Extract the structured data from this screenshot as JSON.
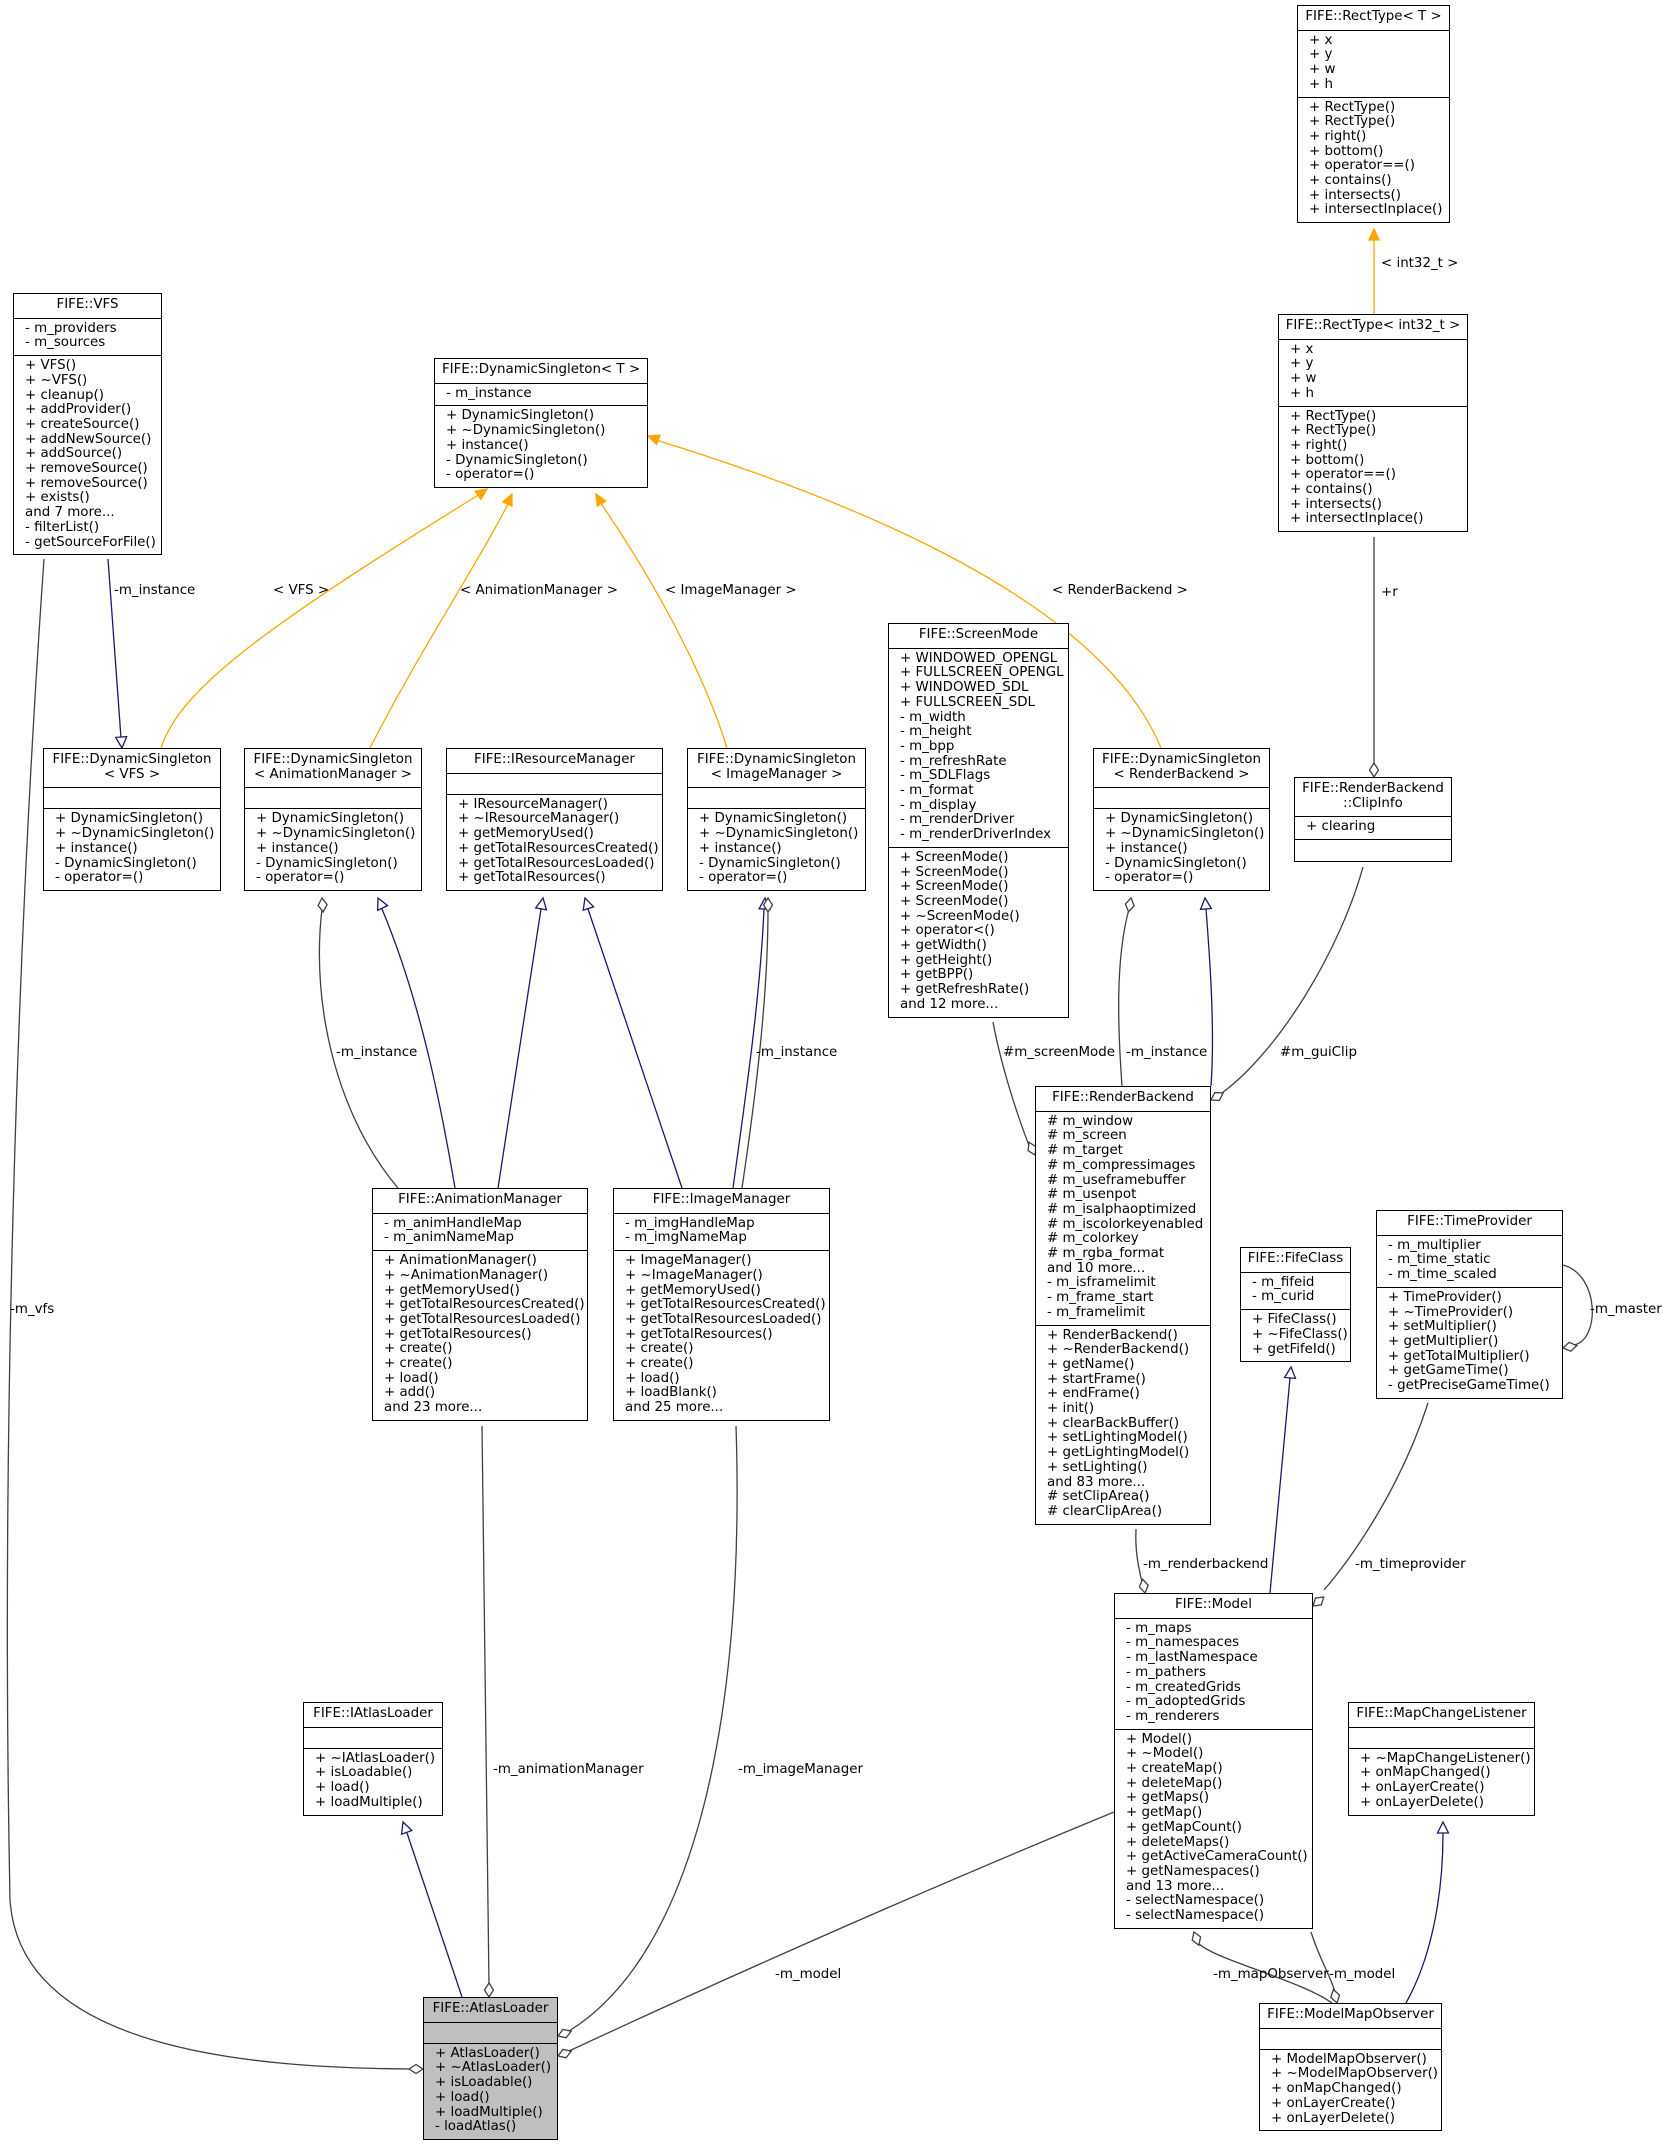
{
  "colors": {
    "inherit": "#191970",
    "template": "#FFA500",
    "usage": "#404040",
    "focus_fill": "#bfbfbf"
  },
  "nodes": [
    {
      "id": "recttype_t",
      "title": "FIFE::RectType< T >",
      "attrs": [
        "+ x",
        "+ y",
        "+ w",
        "+ h"
      ],
      "methods": [
        "+ RectType()",
        "+ RectType()",
        "+ right()",
        "+ bottom()",
        "+ operator==()",
        "+ contains()",
        "+ intersects()",
        "+ intersectInplace()"
      ]
    },
    {
      "id": "recttype_int32",
      "title": "FIFE::RectType< int32_t >",
      "attrs": [
        "+ x",
        "+ y",
        "+ w",
        "+ h"
      ],
      "methods": [
        "+ RectType()",
        "+ RectType()",
        "+ right()",
        "+ bottom()",
        "+ operator==()",
        "+ contains()",
        "+ intersects()",
        "+ intersectInplace()"
      ]
    },
    {
      "id": "vfs",
      "title": "FIFE::VFS",
      "attrs": [
        "- m_providers",
        "- m_sources"
      ],
      "methods": [
        "+ VFS()",
        "+ ~VFS()",
        "+ cleanup()",
        "+ addProvider()",
        "+ createSource()",
        "+ addNewSource()",
        "+ addSource()",
        "+ removeSource()",
        "+ removeSource()",
        "+ exists()",
        "and 7 more...",
        "- filterList()",
        "- getSourceForFile()"
      ]
    },
    {
      "id": "ds_t",
      "title": "FIFE::DynamicSingleton< T >",
      "attrs": [
        "- m_instance"
      ],
      "methods": [
        "+ DynamicSingleton()",
        "+ ~DynamicSingleton()",
        "+ instance()",
        "- DynamicSingleton()",
        "- operator=()"
      ]
    },
    {
      "id": "ds_vfs",
      "title": "FIFE::DynamicSingleton\n< VFS >",
      "attrs": [],
      "methods": [
        "+ DynamicSingleton()",
        "+ ~DynamicSingleton()",
        "+ instance()",
        "- DynamicSingleton()",
        "- operator=()"
      ]
    },
    {
      "id": "ds_anim",
      "title": "FIFE::DynamicSingleton\n< AnimationManager >",
      "attrs": [],
      "methods": [
        "+ DynamicSingleton()",
        "+ ~DynamicSingleton()",
        "+ instance()",
        "- DynamicSingleton()",
        "- operator=()"
      ]
    },
    {
      "id": "iresmgr",
      "title": "FIFE::IResourceManager",
      "attrs": [],
      "methods": [
        "+ IResourceManager()",
        "+ ~IResourceManager()",
        "+ getMemoryUsed()",
        "+ getTotalResourcesCreated()",
        "+ getTotalResourcesLoaded()",
        "+ getTotalResources()"
      ]
    },
    {
      "id": "ds_img",
      "title": "FIFE::DynamicSingleton\n< ImageManager >",
      "attrs": [],
      "methods": [
        "+ DynamicSingleton()",
        "+ ~DynamicSingleton()",
        "+ instance()",
        "- DynamicSingleton()",
        "- operator=()"
      ]
    },
    {
      "id": "screenmode",
      "title": "FIFE::ScreenMode",
      "attrs": [
        "+ WINDOWED_OPENGL",
        "+ FULLSCREEN_OPENGL",
        "+ WINDOWED_SDL",
        "+ FULLSCREEN_SDL",
        "- m_width",
        "- m_height",
        "- m_bpp",
        "- m_refreshRate",
        "- m_SDLFlags",
        "- m_format",
        "- m_display",
        "- m_renderDriver",
        "- m_renderDriverIndex"
      ],
      "methods": [
        "+ ScreenMode()",
        "+ ScreenMode()",
        "+ ScreenMode()",
        "+ ScreenMode()",
        "+ ~ScreenMode()",
        "+ operator<()",
        "+ getWidth()",
        "+ getHeight()",
        "+ getBPP()",
        "+ getRefreshRate()",
        "and 12 more..."
      ]
    },
    {
      "id": "ds_rb",
      "title": "FIFE::DynamicSingleton\n< RenderBackend >",
      "attrs": [],
      "methods": [
        "+ DynamicSingleton()",
        "+ ~DynamicSingleton()",
        "+ instance()",
        "- DynamicSingleton()",
        "- operator=()"
      ]
    },
    {
      "id": "clipinfo",
      "title": "FIFE::RenderBackend\n::ClipInfo",
      "attrs": [
        "+ clearing"
      ],
      "methods": []
    },
    {
      "id": "animmgr",
      "title": "FIFE::AnimationManager",
      "attrs": [
        "- m_animHandleMap",
        "- m_animNameMap"
      ],
      "methods": [
        "+ AnimationManager()",
        "+ ~AnimationManager()",
        "+ getMemoryUsed()",
        "+ getTotalResourcesCreated()",
        "+ getTotalResourcesLoaded()",
        "+ getTotalResources()",
        "+ create()",
        "+ create()",
        "+ load()",
        "+ add()",
        "and 23 more..."
      ]
    },
    {
      "id": "imgmgr",
      "title": "FIFE::ImageManager",
      "attrs": [
        "- m_imgHandleMap",
        "- m_imgNameMap"
      ],
      "methods": [
        "+ ImageManager()",
        "+ ~ImageManager()",
        "+ getMemoryUsed()",
        "+ getTotalResourcesCreated()",
        "+ getTotalResourcesLoaded()",
        "+ getTotalResources()",
        "+ create()",
        "+ create()",
        "+ load()",
        "+ loadBlank()",
        "and 25 more..."
      ]
    },
    {
      "id": "renderbackend",
      "title": "FIFE::RenderBackend",
      "attrs": [
        "# m_window",
        "# m_screen",
        "# m_target",
        "# m_compressimages",
        "# m_useframebuffer",
        "# m_usenpot",
        "# m_isalphaoptimized",
        "# m_iscolorkeyenabled",
        "# m_colorkey",
        "# m_rgba_format",
        "and 10 more...",
        "- m_isframelimit",
        "- m_frame_start",
        "- m_framelimit"
      ],
      "methods": [
        "+ RenderBackend()",
        "+ ~RenderBackend()",
        "+ getName()",
        "+ startFrame()",
        "+ endFrame()",
        "+ init()",
        "+ clearBackBuffer()",
        "+ setLightingModel()",
        "+ getLightingModel()",
        "+ setLighting()",
        "and 83 more...",
        "# setClipArea()",
        "# clearClipArea()"
      ]
    },
    {
      "id": "fifeclass",
      "title": "FIFE::FifeClass",
      "attrs": [
        "- m_fifeid",
        "- m_curid"
      ],
      "methods": [
        "+ FifeClass()",
        "+ ~FifeClass()",
        "+ getFifeId()"
      ]
    },
    {
      "id": "timeprovider",
      "title": "FIFE::TimeProvider",
      "attrs": [
        "- m_multiplier",
        "- m_time_static",
        "- m_time_scaled"
      ],
      "methods": [
        "+ TimeProvider()",
        "+ ~TimeProvider()",
        "+ setMultiplier()",
        "+ getMultiplier()",
        "+ getTotalMultiplier()",
        "+ getGameTime()",
        "- getPreciseGameTime()"
      ]
    },
    {
      "id": "model",
      "title": "FIFE::Model",
      "attrs": [
        "- m_maps",
        "- m_namespaces",
        "- m_lastNamespace",
        "- m_pathers",
        "- m_createdGrids",
        "- m_adoptedGrids",
        "- m_renderers"
      ],
      "methods": [
        "+ Model()",
        "+ ~Model()",
        "+ createMap()",
        "+ deleteMap()",
        "+ getMaps()",
        "+ getMap()",
        "+ getMapCount()",
        "+ deleteMaps()",
        "+ getActiveCameraCount()",
        "+ getNamespaces()",
        "and 13 more...",
        "- selectNamespace()",
        "- selectNamespace()"
      ]
    },
    {
      "id": "iatlasloader",
      "title": "FIFE::IAtlasLoader",
      "attrs": [],
      "methods": [
        "+ ~IAtlasLoader()",
        "+ isLoadable()",
        "+ load()",
        "+ loadMultiple()"
      ]
    },
    {
      "id": "mapchangelistener",
      "title": "FIFE::MapChangeListener",
      "attrs": [],
      "methods": [
        "+ ~MapChangeListener()",
        "+ onMapChanged()",
        "+ onLayerCreate()",
        "+ onLayerDelete()"
      ]
    },
    {
      "id": "atlasloader",
      "title": "FIFE::AtlasLoader",
      "attrs": [],
      "methods": [
        "+ AtlasLoader()",
        "+ ~AtlasLoader()",
        "+ isLoadable()",
        "+ load()",
        "+ loadMultiple()",
        "- loadAtlas()"
      ],
      "focus": true
    },
    {
      "id": "modelmapobserver",
      "title": "FIFE::ModelMapObserver",
      "attrs": [],
      "methods": [
        "+ ModelMapObserver()",
        "+ ~ModelMapObserver()",
        "+ onMapChanged()",
        "+ onLayerCreate()",
        "+ onLayerDelete()"
      ]
    }
  ],
  "edges": [
    {
      "from": "recttype_int32",
      "to": "recttype_t",
      "kind": "template",
      "label": "< int32_t >"
    },
    {
      "from": "ds_vfs",
      "to": "ds_t",
      "kind": "template",
      "label": "< VFS >"
    },
    {
      "from": "ds_anim",
      "to": "ds_t",
      "kind": "template",
      "label": "< AnimationManager >"
    },
    {
      "from": "ds_img",
      "to": "ds_t",
      "kind": "template",
      "label": "< ImageManager >"
    },
    {
      "from": "ds_rb",
      "to": "ds_t",
      "kind": "template",
      "label": "< RenderBackend >"
    },
    {
      "from": "vfs",
      "to": "ds_vfs",
      "kind": "inherit",
      "label": "-m_instance"
    },
    {
      "from": "ds_anim",
      "to": "animmgr",
      "kind": "usage",
      "label": "-m_instance"
    },
    {
      "from": "animmgr",
      "to": "ds_anim",
      "kind": "inherit",
      "label": ""
    },
    {
      "from": "animmgr",
      "to": "iresmgr",
      "kind": "inherit",
      "label": ""
    },
    {
      "from": "imgmgr",
      "to": "iresmgr",
      "kind": "inherit",
      "label": ""
    },
    {
      "from": "imgmgr",
      "to": "ds_img",
      "kind": "inherit",
      "label": ""
    },
    {
      "from": "ds_img",
      "to": "imgmgr",
      "kind": "usage",
      "label": "-m_instance"
    },
    {
      "from": "recttype_int32",
      "to": "clipinfo",
      "kind": "usage",
      "label": "+r"
    },
    {
      "from": "screenmode",
      "to": "renderbackend",
      "kind": "usage",
      "label": "#m_screenMode"
    },
    {
      "from": "ds_rb",
      "to": "renderbackend",
      "kind": "usage",
      "label": "-m_instance"
    },
    {
      "from": "renderbackend",
      "to": "ds_rb",
      "kind": "inherit",
      "label": ""
    },
    {
      "from": "clipinfo",
      "to": "renderbackend",
      "kind": "usage",
      "label": "#m_guiClip"
    },
    {
      "from": "timeprovider",
      "to": "timeprovider",
      "kind": "usage",
      "label": "-m_master"
    },
    {
      "from": "renderbackend",
      "to": "model",
      "kind": "usage",
      "label": "-m_renderbackend"
    },
    {
      "from": "model",
      "to": "fifeclass",
      "kind": "inherit",
      "label": ""
    },
    {
      "from": "timeprovider",
      "to": "model",
      "kind": "usage",
      "label": "-m_timeprovider"
    },
    {
      "from": "vfs",
      "to": "atlasloader",
      "kind": "usage",
      "label": "-m_vfs"
    },
    {
      "from": "animmgr",
      "to": "atlasloader",
      "kind": "usage",
      "label": "-m_animationManager"
    },
    {
      "from": "imgmgr",
      "to": "atlasloader",
      "kind": "usage",
      "label": "-m_imageManager"
    },
    {
      "from": "model",
      "to": "atlasloader",
      "kind": "usage",
      "label": "-m_model"
    },
    {
      "from": "atlasloader",
      "to": "iatlasloader",
      "kind": "inherit",
      "label": ""
    },
    {
      "from": "modelmapobserver",
      "to": "model",
      "kind": "usage",
      "label": "-m_mapObserver"
    },
    {
      "from": "model",
      "to": "modelmapobserver",
      "kind": "usage",
      "label": "-m_model"
    },
    {
      "from": "modelmapobserver",
      "to": "mapchangelistener",
      "kind": "inherit",
      "label": ""
    }
  ]
}
